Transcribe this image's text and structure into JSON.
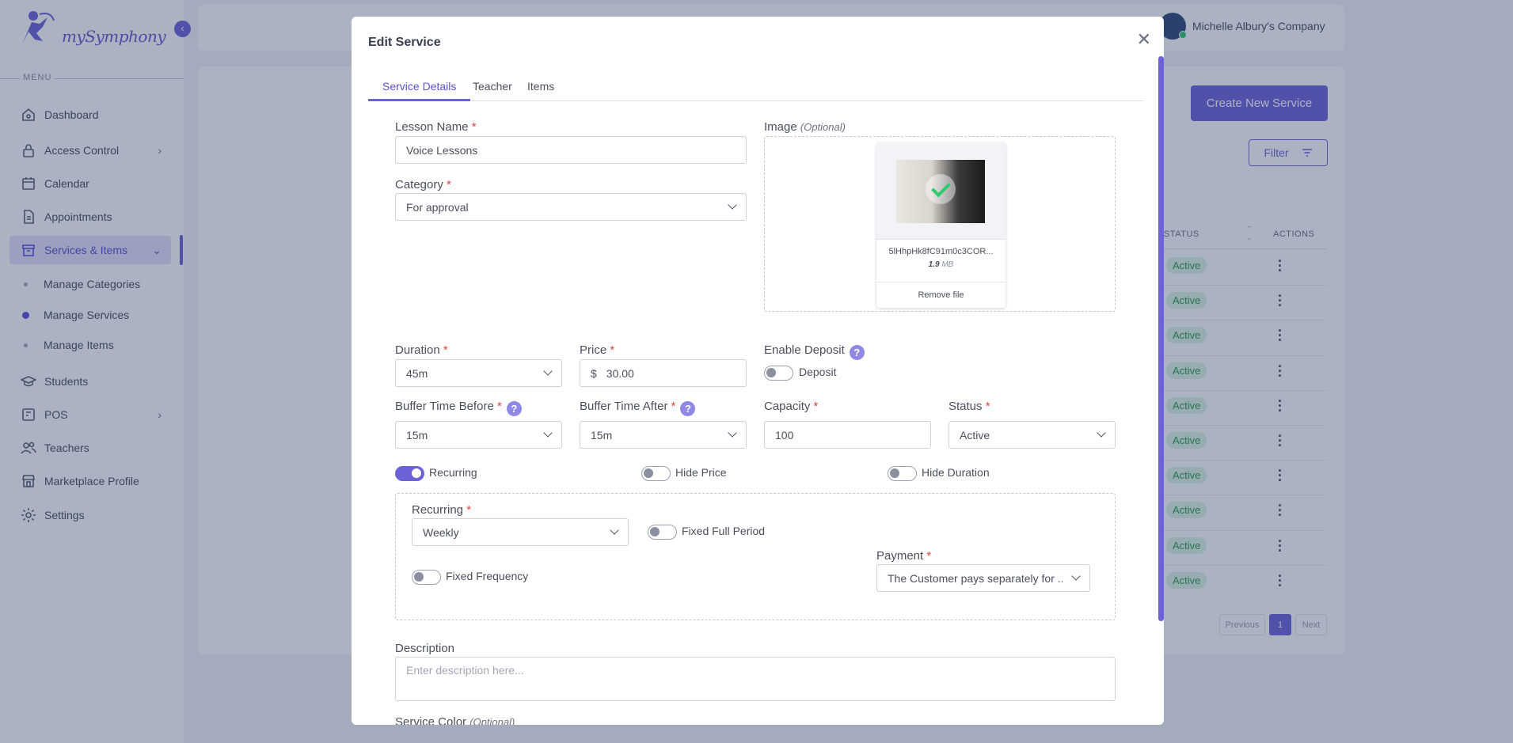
{
  "app": {
    "brand": "mySymphony",
    "company": "Michelle Albury's Company",
    "menu_label": "MENU",
    "nav": [
      {
        "label": "Dashboard",
        "icon": "home-icon"
      },
      {
        "label": "Access Control",
        "icon": "lock-icon"
      },
      {
        "label": "Calendar",
        "icon": "calendar-icon"
      },
      {
        "label": "Appointments",
        "icon": "document-icon"
      },
      {
        "label": "Services & Items",
        "icon": "archive-icon"
      },
      {
        "label": "Students",
        "icon": "graduation-cap-icon"
      },
      {
        "label": "POS",
        "icon": "pos-icon"
      },
      {
        "label": "Teachers",
        "icon": "users-icon"
      },
      {
        "label": "Marketplace Profile",
        "icon": "store-icon"
      },
      {
        "label": "Settings",
        "icon": "gear-icon"
      }
    ],
    "subnav": [
      "Manage Categories",
      "Manage Services",
      "Manage Items"
    ],
    "create_button": "Create New Service",
    "filter_button": "Filter",
    "table": {
      "headers": [
        "STATUS",
        "ACTIONS"
      ],
      "rows": [
        "Active",
        "Active",
        "Active",
        "Active",
        "Active",
        "Active",
        "Active",
        "Active",
        "Active",
        "Active"
      ]
    },
    "pagination": {
      "previous": "Previous",
      "current": "1",
      "next": "Next"
    }
  },
  "modal": {
    "title": "Edit Service",
    "tabs": [
      "Service Details",
      "Teacher",
      "Items"
    ],
    "active_tab": "Service Details",
    "lesson_name": {
      "label": "Lesson Name",
      "value": "Voice Lessons"
    },
    "category": {
      "label": "Category",
      "value": "For approval"
    },
    "image": {
      "label": "Image",
      "optional": "(Optional)",
      "file_name": "5lHhpHk8fC91m0c3COR...",
      "file_size_num": "1.9",
      "file_size_unit": "MB",
      "remove_label": "Remove file"
    },
    "duration": {
      "label": "Duration",
      "value": "45m"
    },
    "price": {
      "label": "Price",
      "currency": "$",
      "value": "30.00"
    },
    "deposit": {
      "label": "Enable Deposit",
      "toggle_label": "Deposit",
      "enabled": false
    },
    "buffer_before": {
      "label": "Buffer Time Before",
      "value": "15m"
    },
    "buffer_after": {
      "label": "Buffer Time After",
      "value": "15m"
    },
    "capacity": {
      "label": "Capacity",
      "value": "100"
    },
    "status": {
      "label": "Status",
      "value": "Active"
    },
    "toggles": {
      "recurring": {
        "label": "Recurring",
        "on": true
      },
      "hide_price": {
        "label": "Hide Price",
        "on": false
      },
      "hide_duration": {
        "label": "Hide Duration",
        "on": false
      }
    },
    "recurring_panel": {
      "recurring": {
        "label": "Recurring",
        "value": "Weekly"
      },
      "fixed_full_period": {
        "label": "Fixed Full Period",
        "on": false
      },
      "fixed_frequency": {
        "label": "Fixed Frequency",
        "on": false
      },
      "payment": {
        "label": "Payment",
        "value": "The Customer pays separately for ..."
      }
    },
    "description": {
      "label": "Description",
      "placeholder": "Enter description here..."
    },
    "service_color": {
      "label": "Service Color",
      "optional": "(Optional)"
    },
    "required_mark": "*",
    "help_mark": "?"
  },
  "colors": {
    "accent": "#6c63d9",
    "required": "#e0453c",
    "active_badge": "#2e9d4e"
  }
}
